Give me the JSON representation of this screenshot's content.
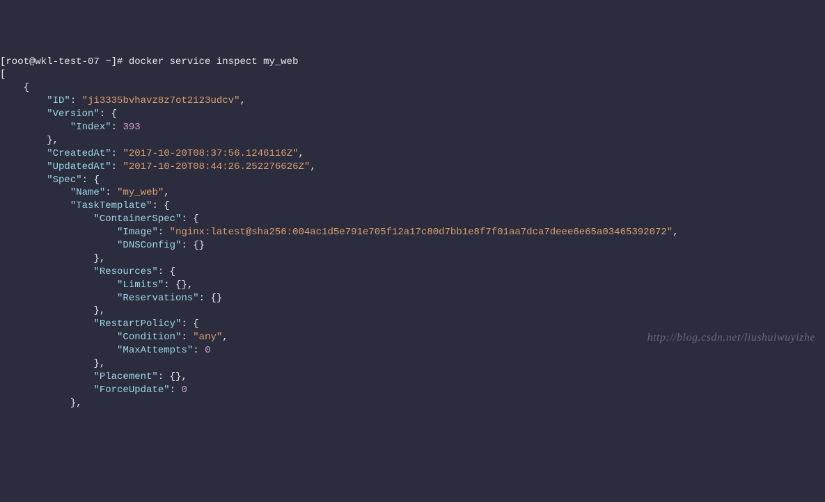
{
  "prompt": "[root@wkl-test-07 ~]# ",
  "command": "docker service inspect my_web",
  "json": {
    "ID": "ji3335bvhavz8z7ot2i23udcv",
    "Version": {
      "Index": 393
    },
    "CreatedAt": "2017-10-20T08:37:56.1246116Z",
    "UpdatedAt": "2017-10-20T08:44:26.252276626Z",
    "Spec": {
      "Name": "my_web",
      "TaskTemplate": {
        "ContainerSpec": {
          "Image": "nginx:latest@sha256:004ac1d5e791e705f12a17c80d7bb1e8f7f01aa7dca7deee6e65a03465392072",
          "DNSConfig": {}
        },
        "Resources": {
          "Limits": {},
          "Reservations": {}
        },
        "RestartPolicy": {
          "Condition": "any",
          "MaxAttempts": 0
        },
        "Placement": {},
        "ForceUpdate": 0
      }
    }
  },
  "watermark": "http://blog.csdn.net/liushuiwuyizhe"
}
